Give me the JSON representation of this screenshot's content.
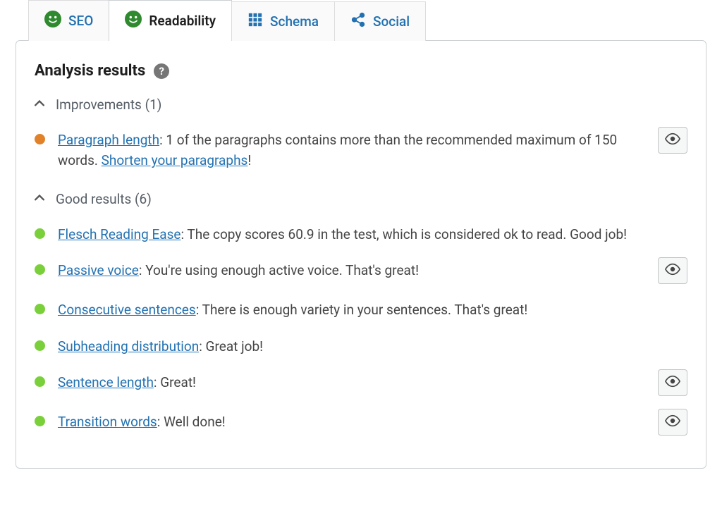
{
  "colors": {
    "link": "#2271b1",
    "text": "#444444",
    "green": "#7ad03a",
    "orange": "#e1822a",
    "face_green": "#2f8a2f"
  },
  "tabs": [
    {
      "label": "SEO"
    },
    {
      "label": "Readability"
    },
    {
      "label": "Schema"
    },
    {
      "label": "Social"
    }
  ],
  "panel": {
    "title": "Analysis results",
    "help_glyph": "?",
    "sections": {
      "improvements": {
        "label_prefix": "Improvements (",
        "count": "1",
        "label_suffix": ")",
        "items": [
          {
            "link1": "Paragraph length",
            "text1": ": 1 of the paragraphs contains more than the recommended maximum of 150 words. ",
            "link2": "Shorten your paragraphs",
            "text2": "!"
          }
        ]
      },
      "good": {
        "label_prefix": "Good results (",
        "count": "6",
        "label_suffix": ")",
        "items": [
          {
            "link": "Flesch Reading Ease",
            "text": ": The copy scores 60.9 in the test, which is considered ok to read. Good job!"
          },
          {
            "link": "Passive voice",
            "text": ": You're using enough active voice. That's great!"
          },
          {
            "link": "Consecutive sentences",
            "text": ": There is enough variety in your sentences. That's great!"
          },
          {
            "link": "Subheading distribution",
            "text": ": Great job!"
          },
          {
            "link": "Sentence length",
            "text": ": Great!"
          },
          {
            "link": "Transition words",
            "text": ": Well done!"
          }
        ]
      }
    }
  }
}
